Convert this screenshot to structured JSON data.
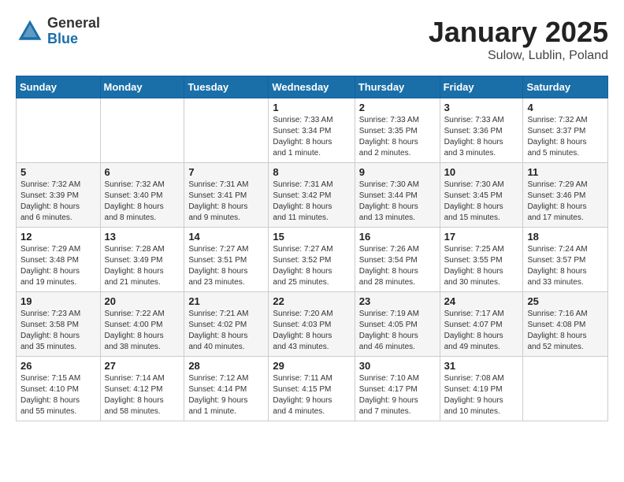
{
  "header": {
    "logo_general": "General",
    "logo_blue": "Blue",
    "month_title": "January 2025",
    "subtitle": "Sulow, Lublin, Poland"
  },
  "days_of_week": [
    "Sunday",
    "Monday",
    "Tuesday",
    "Wednesday",
    "Thursday",
    "Friday",
    "Saturday"
  ],
  "weeks": [
    [
      {
        "day": "",
        "info": ""
      },
      {
        "day": "",
        "info": ""
      },
      {
        "day": "",
        "info": ""
      },
      {
        "day": "1",
        "info": "Sunrise: 7:33 AM\nSunset: 3:34 PM\nDaylight: 8 hours\nand 1 minute."
      },
      {
        "day": "2",
        "info": "Sunrise: 7:33 AM\nSunset: 3:35 PM\nDaylight: 8 hours\nand 2 minutes."
      },
      {
        "day": "3",
        "info": "Sunrise: 7:33 AM\nSunset: 3:36 PM\nDaylight: 8 hours\nand 3 minutes."
      },
      {
        "day": "4",
        "info": "Sunrise: 7:32 AM\nSunset: 3:37 PM\nDaylight: 8 hours\nand 5 minutes."
      }
    ],
    [
      {
        "day": "5",
        "info": "Sunrise: 7:32 AM\nSunset: 3:39 PM\nDaylight: 8 hours\nand 6 minutes."
      },
      {
        "day": "6",
        "info": "Sunrise: 7:32 AM\nSunset: 3:40 PM\nDaylight: 8 hours\nand 8 minutes."
      },
      {
        "day": "7",
        "info": "Sunrise: 7:31 AM\nSunset: 3:41 PM\nDaylight: 8 hours\nand 9 minutes."
      },
      {
        "day": "8",
        "info": "Sunrise: 7:31 AM\nSunset: 3:42 PM\nDaylight: 8 hours\nand 11 minutes."
      },
      {
        "day": "9",
        "info": "Sunrise: 7:30 AM\nSunset: 3:44 PM\nDaylight: 8 hours\nand 13 minutes."
      },
      {
        "day": "10",
        "info": "Sunrise: 7:30 AM\nSunset: 3:45 PM\nDaylight: 8 hours\nand 15 minutes."
      },
      {
        "day": "11",
        "info": "Sunrise: 7:29 AM\nSunset: 3:46 PM\nDaylight: 8 hours\nand 17 minutes."
      }
    ],
    [
      {
        "day": "12",
        "info": "Sunrise: 7:29 AM\nSunset: 3:48 PM\nDaylight: 8 hours\nand 19 minutes."
      },
      {
        "day": "13",
        "info": "Sunrise: 7:28 AM\nSunset: 3:49 PM\nDaylight: 8 hours\nand 21 minutes."
      },
      {
        "day": "14",
        "info": "Sunrise: 7:27 AM\nSunset: 3:51 PM\nDaylight: 8 hours\nand 23 minutes."
      },
      {
        "day": "15",
        "info": "Sunrise: 7:27 AM\nSunset: 3:52 PM\nDaylight: 8 hours\nand 25 minutes."
      },
      {
        "day": "16",
        "info": "Sunrise: 7:26 AM\nSunset: 3:54 PM\nDaylight: 8 hours\nand 28 minutes."
      },
      {
        "day": "17",
        "info": "Sunrise: 7:25 AM\nSunset: 3:55 PM\nDaylight: 8 hours\nand 30 minutes."
      },
      {
        "day": "18",
        "info": "Sunrise: 7:24 AM\nSunset: 3:57 PM\nDaylight: 8 hours\nand 33 minutes."
      }
    ],
    [
      {
        "day": "19",
        "info": "Sunrise: 7:23 AM\nSunset: 3:58 PM\nDaylight: 8 hours\nand 35 minutes."
      },
      {
        "day": "20",
        "info": "Sunrise: 7:22 AM\nSunset: 4:00 PM\nDaylight: 8 hours\nand 38 minutes."
      },
      {
        "day": "21",
        "info": "Sunrise: 7:21 AM\nSunset: 4:02 PM\nDaylight: 8 hours\nand 40 minutes."
      },
      {
        "day": "22",
        "info": "Sunrise: 7:20 AM\nSunset: 4:03 PM\nDaylight: 8 hours\nand 43 minutes."
      },
      {
        "day": "23",
        "info": "Sunrise: 7:19 AM\nSunset: 4:05 PM\nDaylight: 8 hours\nand 46 minutes."
      },
      {
        "day": "24",
        "info": "Sunrise: 7:17 AM\nSunset: 4:07 PM\nDaylight: 8 hours\nand 49 minutes."
      },
      {
        "day": "25",
        "info": "Sunrise: 7:16 AM\nSunset: 4:08 PM\nDaylight: 8 hours\nand 52 minutes."
      }
    ],
    [
      {
        "day": "26",
        "info": "Sunrise: 7:15 AM\nSunset: 4:10 PM\nDaylight: 8 hours\nand 55 minutes."
      },
      {
        "day": "27",
        "info": "Sunrise: 7:14 AM\nSunset: 4:12 PM\nDaylight: 8 hours\nand 58 minutes."
      },
      {
        "day": "28",
        "info": "Sunrise: 7:12 AM\nSunset: 4:14 PM\nDaylight: 9 hours\nand 1 minute."
      },
      {
        "day": "29",
        "info": "Sunrise: 7:11 AM\nSunset: 4:15 PM\nDaylight: 9 hours\nand 4 minutes."
      },
      {
        "day": "30",
        "info": "Sunrise: 7:10 AM\nSunset: 4:17 PM\nDaylight: 9 hours\nand 7 minutes."
      },
      {
        "day": "31",
        "info": "Sunrise: 7:08 AM\nSunset: 4:19 PM\nDaylight: 9 hours\nand 10 minutes."
      },
      {
        "day": "",
        "info": ""
      }
    ]
  ]
}
